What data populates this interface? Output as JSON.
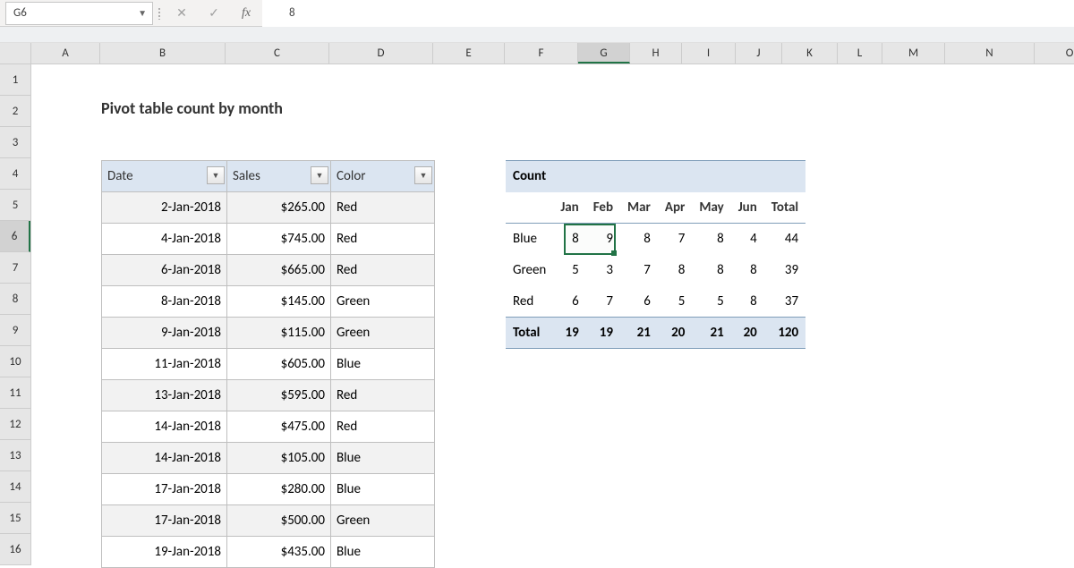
{
  "active_cell": {
    "ref": "G6",
    "value": "8"
  },
  "columns": [
    "A",
    "B",
    "C",
    "D",
    "E",
    "F",
    "G",
    "H",
    "I",
    "J",
    "K",
    "L",
    "M",
    "N",
    "O"
  ],
  "rows": [
    1,
    2,
    3,
    4,
    5,
    6,
    7,
    8,
    9,
    10,
    11,
    12,
    13,
    14,
    15,
    16
  ],
  "title": "Pivot table count by month",
  "src": {
    "headers": {
      "date": "Date",
      "sales": "Sales",
      "color": "Color"
    },
    "rows": [
      {
        "date": "2-Jan-2018",
        "sales": "$265.00",
        "color": "Red",
        "band": true
      },
      {
        "date": "4-Jan-2018",
        "sales": "$745.00",
        "color": "Red",
        "band": false
      },
      {
        "date": "6-Jan-2018",
        "sales": "$665.00",
        "color": "Red",
        "band": true
      },
      {
        "date": "8-Jan-2018",
        "sales": "$145.00",
        "color": "Green",
        "band": false
      },
      {
        "date": "9-Jan-2018",
        "sales": "$115.00",
        "color": "Green",
        "band": true
      },
      {
        "date": "11-Jan-2018",
        "sales": "$605.00",
        "color": "Blue",
        "band": false
      },
      {
        "date": "13-Jan-2018",
        "sales": "$595.00",
        "color": "Red",
        "band": true
      },
      {
        "date": "14-Jan-2018",
        "sales": "$475.00",
        "color": "Red",
        "band": false
      },
      {
        "date": "14-Jan-2018",
        "sales": "$105.00",
        "color": "Blue",
        "band": true
      },
      {
        "date": "17-Jan-2018",
        "sales": "$280.00",
        "color": "Blue",
        "band": false
      },
      {
        "date": "17-Jan-2018",
        "sales": "$500.00",
        "color": "Green",
        "band": true
      },
      {
        "date": "19-Jan-2018",
        "sales": "$435.00",
        "color": "Blue",
        "band": false
      }
    ]
  },
  "pivot": {
    "label": "Count",
    "col_headers": [
      "Jan",
      "Feb",
      "Mar",
      "Apr",
      "May",
      "Jun",
      "Total"
    ],
    "rows": [
      {
        "name": "Blue",
        "vals": [
          "8",
          "9",
          "8",
          "7",
          "8",
          "4",
          "44"
        ]
      },
      {
        "name": "Green",
        "vals": [
          "5",
          "3",
          "7",
          "8",
          "8",
          "8",
          "39"
        ]
      },
      {
        "name": "Red",
        "vals": [
          "6",
          "7",
          "6",
          "5",
          "5",
          "8",
          "37"
        ]
      }
    ],
    "total": {
      "name": "Total",
      "vals": [
        "19",
        "19",
        "21",
        "20",
        "21",
        "20",
        "120"
      ]
    }
  },
  "chart_data": {
    "type": "table",
    "title": "Pivot table count by month",
    "columns": [
      "Color",
      "Jan",
      "Feb",
      "Mar",
      "Apr",
      "May",
      "Jun",
      "Total"
    ],
    "rows": [
      [
        "Blue",
        8,
        9,
        8,
        7,
        8,
        4,
        44
      ],
      [
        "Green",
        5,
        3,
        7,
        8,
        8,
        8,
        39
      ],
      [
        "Red",
        6,
        7,
        6,
        5,
        5,
        8,
        37
      ],
      [
        "Total",
        19,
        19,
        21,
        20,
        21,
        20,
        120
      ]
    ]
  }
}
